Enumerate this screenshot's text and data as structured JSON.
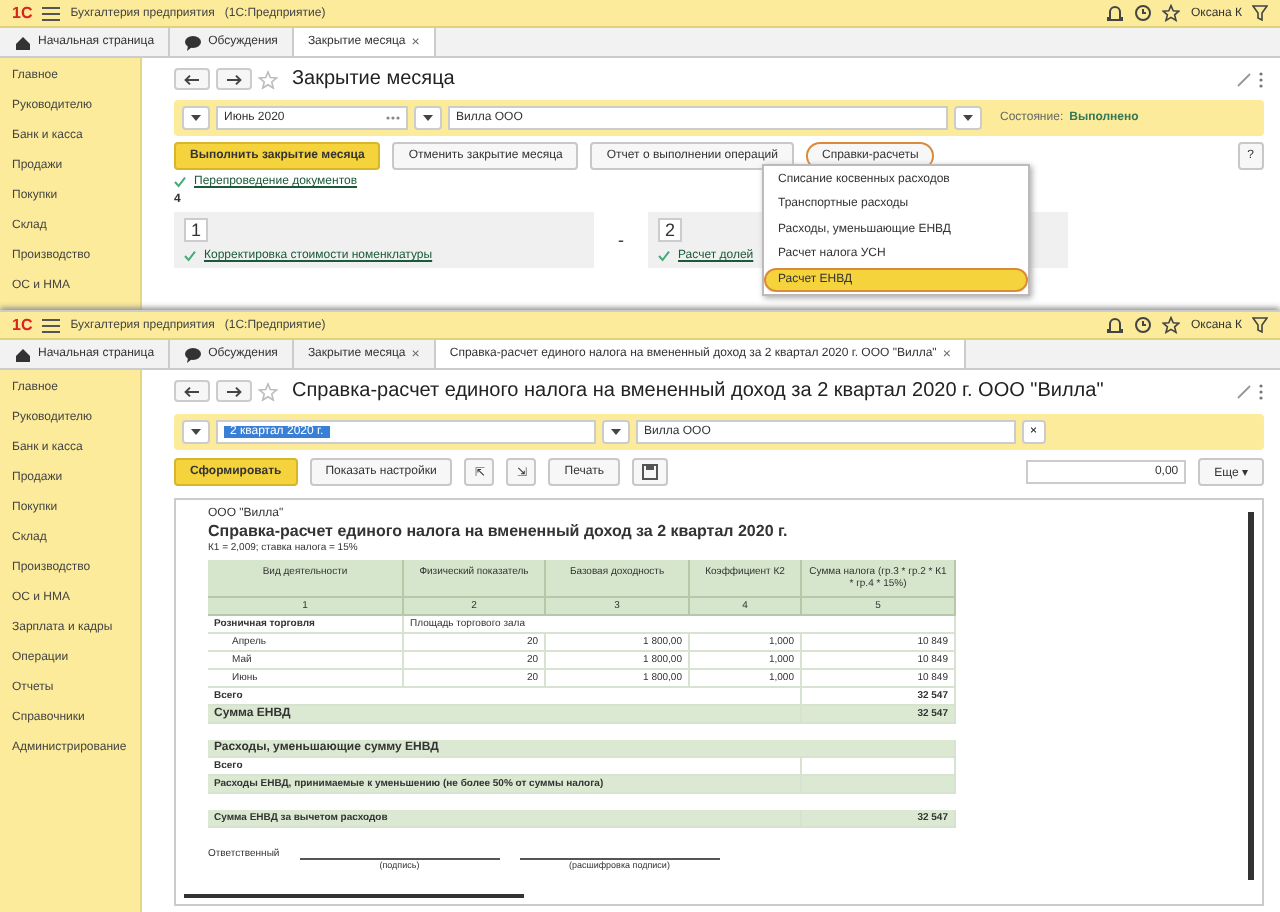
{
  "back_window": {
    "logo": "1С",
    "title": "Бухгалтерия предприятия",
    "subtitle": "(1С:Предприятие)",
    "user": "Оксана К",
    "tabs": [
      {
        "label": "Начальная страница",
        "kind": "home",
        "selected": false
      },
      {
        "label": "Обсуждения",
        "kind": "chat",
        "selected": false
      },
      {
        "label": "Закрытие месяца",
        "kind": "form",
        "close": "×",
        "selected": true
      }
    ],
    "sidebar": [
      "Главное",
      "Руководителю",
      "Банк и касса",
      "Продажи",
      "Покупки",
      "Склад",
      "Производство",
      "ОС и НМА"
    ],
    "form": {
      "title": "Закрытие месяца",
      "period": "Июнь 2020",
      "organization": "Вилла ООО",
      "state_label": "Состояние:",
      "state": "Выполнено",
      "buttons": [
        {
          "label": "Выполнить закрытие месяца",
          "kind": "primary",
          "highlighted": false
        },
        {
          "label": "Отменить закрытие месяца",
          "kind": "normal",
          "highlighted": false
        },
        {
          "label": "Отчет о выполнении операций",
          "kind": "normal",
          "highlighted": false
        },
        {
          "label": "Справки-расчеты",
          "kind": "normal",
          "highlighted": true
        }
      ],
      "help": "?",
      "link": "Перепроведение документов",
      "count": "4",
      "steps": [
        {
          "number": "1",
          "link": "Корректировка стоимости номенклатуры"
        },
        {
          "number": "2",
          "link": "Расчет долей"
        }
      ],
      "step_separator": "-",
      "menu": [
        {
          "label": "Списание косвенных расходов",
          "selected": false,
          "highlighted": false
        },
        {
          "label": "Транспортные расходы",
          "selected": false,
          "highlighted": false
        },
        {
          "label": "Расходы, уменьшающие ЕНВД",
          "selected": false,
          "highlighted": false
        },
        {
          "label": "Расчет налога УСН",
          "selected": false,
          "highlighted": false
        },
        {
          "label": "Расчет ЕНВД",
          "selected": true,
          "highlighted": true
        }
      ]
    }
  },
  "front_window": {
    "logo": "1С",
    "title": "Бухгалтерия предприятия",
    "subtitle": "(1С:Предприятие)",
    "user": "Оксана К",
    "tabs": [
      {
        "label": "Начальная страница",
        "kind": "home",
        "selected": false
      },
      {
        "label": "Обсуждения",
        "kind": "chat",
        "selected": false
      },
      {
        "label": "Закрытие месяца",
        "kind": "form",
        "close": "×",
        "selected": false
      },
      {
        "label": "Справка-расчет единого налога на вмененный доход за 2 квартал 2020 г. ООО \"Вилла\"",
        "kind": "form",
        "close": "×",
        "selected": true
      }
    ],
    "sidebar": [
      "Главное",
      "Руководителю",
      "Банк и касса",
      "Продажи",
      "Покупки",
      "Склад",
      "Производство",
      "ОС и НМА",
      "Зарплата и кадры",
      "Операции",
      "Отчеты",
      "Справочники",
      "Администрирование"
    ],
    "form": {
      "title": "Справка-расчет единого налога на вмененный доход за 2 квартал 2020 г. ООО \"Вилла\"",
      "period": "2 квартал 2020 г.",
      "organization": "Вилла ООО",
      "clear": "×",
      "buttons": [
        {
          "label": "Сформировать",
          "kind": "primary"
        },
        {
          "label": "Показать настройки",
          "kind": "normal"
        },
        {
          "label": "⇱",
          "kind": "icon"
        },
        {
          "label": "⇲",
          "kind": "icon"
        },
        {
          "label": "Печать",
          "kind": "normal"
        },
        {
          "kind": "save"
        }
      ],
      "scale": "0,00",
      "more": "Еще ▾",
      "report": {
        "org": "ООО \"Вилла\"",
        "title": "Справка-расчет единого налога на вмененный доход за 2 квартал 2020 г.",
        "note": "К1 = 2,009; ставка налога = 15%",
        "columns": [
          "Вид деятельности",
          "Физический показатель",
          "Базовая доходность",
          "Коэффициент К2",
          "Сумма налога (гр.3 * гр.2 * К1 * гр.4 * 15%)"
        ],
        "column_numbers": [
          "1",
          "2",
          "3",
          "4",
          "5"
        ],
        "group": {
          "label": "Розничная торговля",
          "indicator": "Площадь торгового зала"
        },
        "rows": [
          [
            "Апрель",
            "20",
            "1 800,00",
            "1,000",
            "10 849"
          ],
          [
            "Май",
            "20",
            "1 800,00",
            "1,000",
            "10 849"
          ],
          [
            "Июнь",
            "20",
            "1 800,00",
            "1,000",
            "10 849"
          ]
        ],
        "total": {
          "label": "Всего",
          "value": "32 547"
        },
        "tax": {
          "label": "Сумма ЕНВД",
          "value": "32 547"
        },
        "expenses": "Расходы, уменьшающие сумму ЕНВД",
        "expenses_total": "Всего",
        "expenses_accepted": "Расходы ЕНВД, принимаемые к уменьшению (не более 50% от суммы налога)",
        "result": {
          "label": "Сумма ЕНВД за вычетом расходов",
          "value": "32 547"
        },
        "signature": {
          "label": "Ответственный",
          "captions": [
            "(подпись)",
            "(расшифровка подписи)"
          ]
        }
      }
    }
  }
}
